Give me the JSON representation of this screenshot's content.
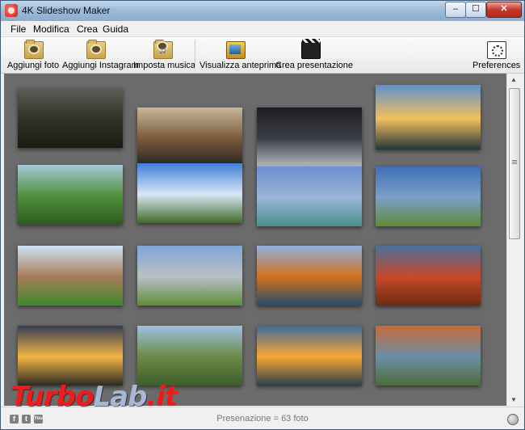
{
  "window": {
    "title": "4K Slideshow Maker",
    "min_glyph": "–",
    "max_glyph": "☐",
    "close_glyph": "✕"
  },
  "menu": [
    "File",
    "Modifica",
    "Crea",
    "Guida"
  ],
  "toolbar": {
    "add_photo": "Aggiungi foto",
    "add_instagram": "Aggiungi Instagram",
    "set_music": "Imposta musica",
    "preview": "Visualizza anteprima",
    "create_slideshow": "Crea presentazione",
    "preferences": "Preferences"
  },
  "gallery": {
    "photos": [
      {
        "name": "photo-misty-valley",
        "colors": [
          "#5b5f58",
          "#2f3224",
          "#1a1b12"
        ]
      },
      {
        "name": "photo-planet-surreal",
        "colors": [
          "#c7b89a",
          "#7a5a3a",
          "#252323"
        ]
      },
      {
        "name": "photo-dark-waterfall",
        "colors": [
          "#1d1d22",
          "#3c3f46",
          "#b9bcc2"
        ]
      },
      {
        "name": "photo-mountain-lake-sunset",
        "colors": [
          "#5f8fd0",
          "#f2c05c",
          "#26363a"
        ]
      },
      {
        "name": "photo-green-ridges",
        "colors": [
          "#a9c9d9",
          "#4f8f3b",
          "#2c5a1d"
        ]
      },
      {
        "name": "photo-forest-river",
        "colors": [
          "#3f7fd8",
          "#d9e7f5",
          "#3f6b2a"
        ]
      },
      {
        "name": "photo-alpine-lake",
        "colors": [
          "#6b8fd1",
          "#9ab6d6",
          "#47908a"
        ]
      },
      {
        "name": "photo-village-hills",
        "colors": [
          "#3f6fb8",
          "#7aa0c8",
          "#5f8a36"
        ]
      },
      {
        "name": "photo-rock-fortress",
        "colors": [
          "#cfe3f6",
          "#a77b5a",
          "#3e8a2b"
        ]
      },
      {
        "name": "photo-snowy-peaks",
        "colors": [
          "#7fa6d6",
          "#b9c0c6",
          "#5d8d3a"
        ]
      },
      {
        "name": "photo-autumn-boat",
        "colors": [
          "#8fb2e0",
          "#d4701c",
          "#254d6a"
        ]
      },
      {
        "name": "photo-red-tree",
        "colors": [
          "#4a6e9a",
          "#c64a2a",
          "#6e2a12"
        ]
      },
      {
        "name": "photo-sunset-lake",
        "colors": [
          "#333c54",
          "#f3b544",
          "#2c2a24"
        ]
      },
      {
        "name": "photo-grass-ladder",
        "colors": [
          "#9fc1e0",
          "#6a8a48",
          "#3f5e2a"
        ]
      },
      {
        "name": "photo-sunset-coast",
        "colors": [
          "#3f6a9a",
          "#f8a734",
          "#2b3f4d"
        ]
      },
      {
        "name": "photo-rice-terraces",
        "colors": [
          "#c86a3a",
          "#6a8fa6",
          "#4e6b3a"
        ]
      }
    ]
  },
  "status": {
    "count_text": "Presenazione = 63 foto",
    "facebook": "f",
    "twitter": "t",
    "youtube": "You"
  },
  "watermark": {
    "part1": "Turbo",
    "part2": "Lab",
    "part3": ".it"
  }
}
